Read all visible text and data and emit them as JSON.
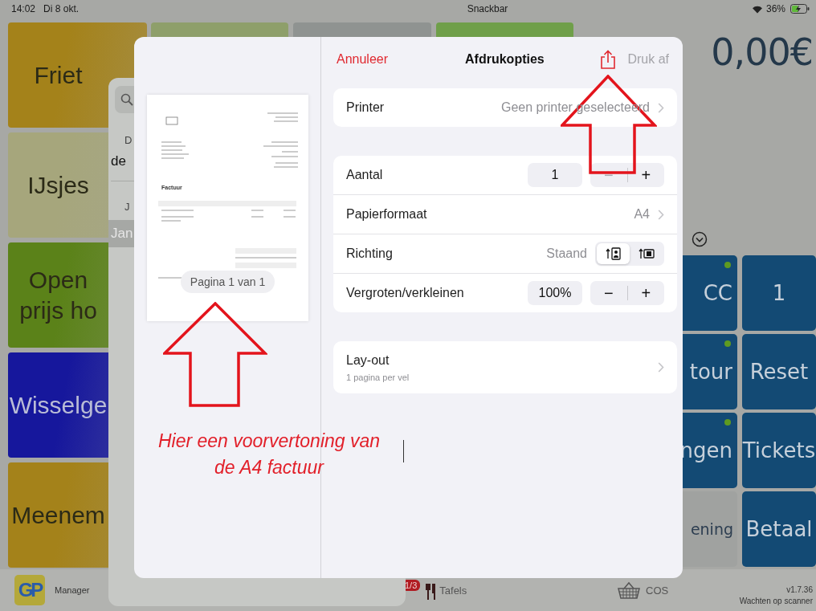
{
  "status_bar": {
    "time": "14:02",
    "date": "Di 8 okt.",
    "title": "Snackbar",
    "battery": "36%"
  },
  "categories": [
    {
      "label": "Friet",
      "color": "#a4821a"
    },
    {
      "label": "IJsjes",
      "color": "#a6a67c"
    },
    {
      "label": "Open\nprijs ho",
      "color": "#5b8219"
    },
    {
      "label": "Wisselge",
      "color": "#16179c"
    },
    {
      "label": "Meenem",
      "color": "#a4821a"
    }
  ],
  "top_tiles": [
    {
      "color": "#8e9f6a"
    },
    {
      "color": "#8f9391"
    },
    {
      "color": "#6f9f49"
    }
  ],
  "total": "0,00€",
  "function_keys": [
    {
      "label": "CC",
      "kind": "primary",
      "indicator": true
    },
    {
      "label": "1",
      "kind": "primary",
      "indicator": false
    },
    {
      "label": "tour",
      "kind": "primary",
      "indicator": true
    },
    {
      "label": "Reset",
      "kind": "primary",
      "indicator": false
    },
    {
      "label": "ngen",
      "kind": "primary",
      "indicator": true
    },
    {
      "label": "Tickets",
      "kind": "primary",
      "indicator": false
    },
    {
      "label": "ening",
      "kind": "secondary",
      "indicator": false
    },
    {
      "label": "Betaal",
      "kind": "primary",
      "indicator": false
    }
  ],
  "customer_sheet": {
    "rows": [
      {
        "kind": "header",
        "label": "D"
      },
      {
        "kind": "item",
        "label": "de",
        "selected": false
      },
      {
        "kind": "header",
        "label": "J"
      },
      {
        "kind": "item",
        "label": "Jan",
        "selected": true
      }
    ]
  },
  "bottom_bar": {
    "logo": "GP",
    "manager": "Manager",
    "tables": {
      "label": "Tafels",
      "badge": "1/3"
    },
    "cos": "COS",
    "version": "v1.7.36",
    "status": "Wachten op scanner"
  },
  "print_dialog": {
    "cancel": "Annuleer",
    "title": "Afdrukopties",
    "print_button": {
      "label": "Druk af",
      "disabled": true
    },
    "preview": {
      "heading": "Factuur",
      "page_label": "Pagina 1 van 1"
    },
    "groups": [
      [
        {
          "kind": "link",
          "label": "Printer",
          "value": "Geen printer geselecteerd"
        }
      ],
      [
        {
          "kind": "stepper",
          "label": "Aantal",
          "value": "1",
          "decrement": "−",
          "increment": "+",
          "decrement_disabled": true
        },
        {
          "kind": "link",
          "label": "Papierformaat",
          "value": "A4"
        },
        {
          "kind": "orientation",
          "label": "Richting",
          "value": "Staand",
          "options": [
            {
              "selected": true
            },
            {
              "selected": false
            }
          ]
        },
        {
          "kind": "stepper",
          "label": "Vergroten/verkleinen",
          "value": "100%",
          "decrement": "−",
          "increment": "+",
          "decrement_disabled": false
        }
      ],
      [
        {
          "kind": "link",
          "label": "Lay-out",
          "subtitle": "1 pagina per vel"
        }
      ]
    ]
  },
  "annotation": "Hier een voorvertoning van\nde A4 factuur"
}
